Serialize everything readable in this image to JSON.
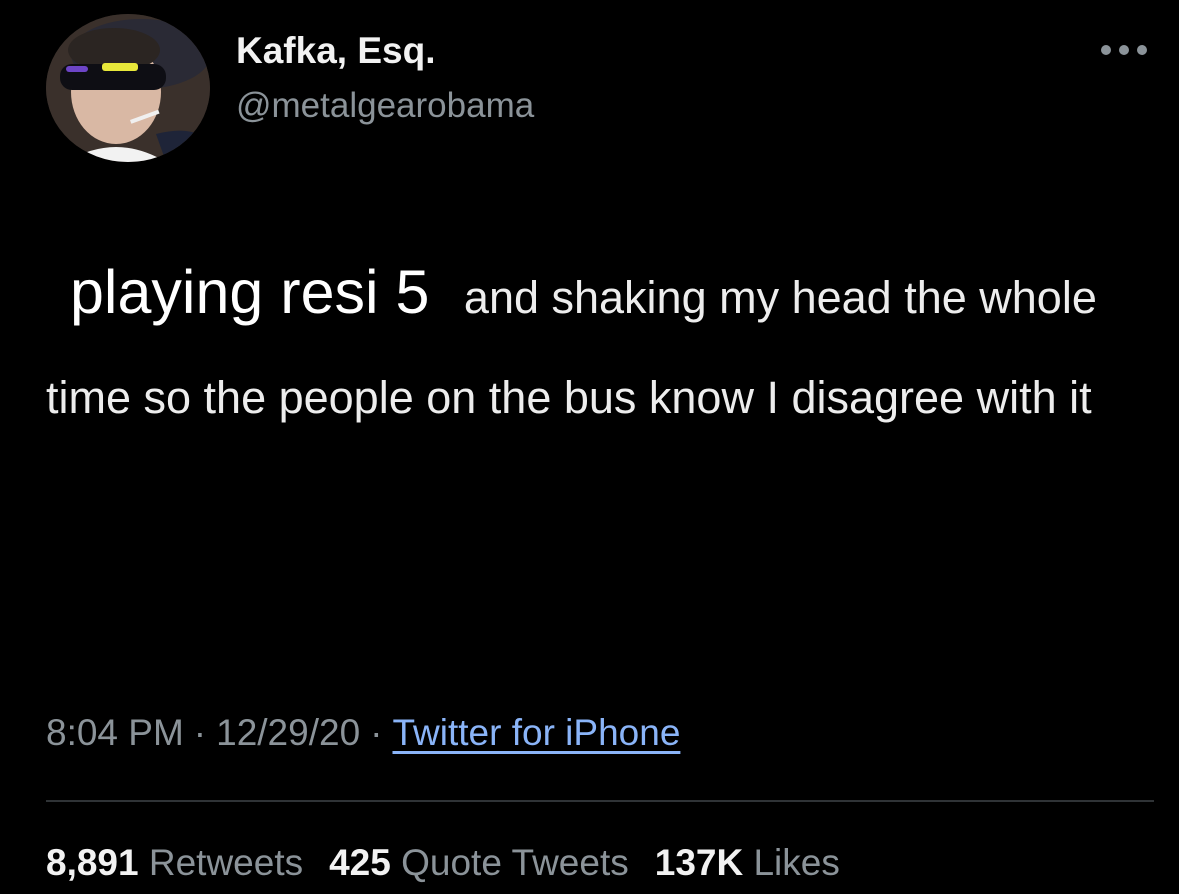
{
  "user": {
    "display_name": "Kafka, Esq.",
    "handle": "@metalgearobama",
    "avatar_icon": "profile-photo"
  },
  "more_icon": "more-options-icon",
  "tweet": {
    "sticker_text": "playing resi 5",
    "body_rest": " and shaking my head the whole time so the people on the bus know I disagree with it"
  },
  "meta": {
    "time": "8:04 PM",
    "separator": "·",
    "date": "12/29/20",
    "source": "Twitter for iPhone"
  },
  "stats": {
    "retweets_count": "8,891",
    "retweets_label": "Retweets",
    "quotes_count": "425",
    "quotes_label": "Quote Tweets",
    "likes_count": "137K",
    "likes_label": "Likes"
  },
  "colors": {
    "background": "#000000",
    "text": "#ededed",
    "secondary_text": "#8b9399",
    "link": "#8ab4f8",
    "divider": "#2f3336"
  }
}
